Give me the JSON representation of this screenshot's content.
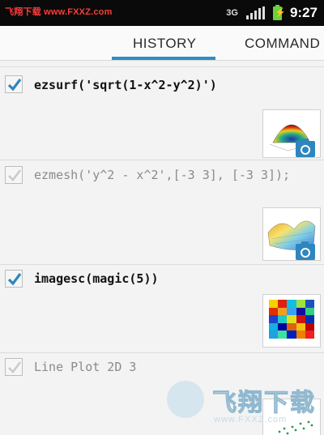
{
  "status_bar": {
    "watermark_prefix": "飞翔下载",
    "watermark_url": "www.FXXZ.com",
    "network_label": "3G",
    "time": "9:27"
  },
  "tabs": {
    "history_label": "HISTORY",
    "command_label": "COMMAND",
    "active": "HISTORY",
    "accent_color": "#2d8ec4"
  },
  "history_items": [
    {
      "command": "ezsurf('sqrt(1-x^2-y^2)')",
      "checked": true,
      "has_figure": true,
      "figure_icon": "surface-plot-thumbnail"
    },
    {
      "command": "ezmesh('y^2 - x^2',[-3 3], [-3 3]);",
      "checked": false,
      "has_figure": true,
      "figure_icon": "mesh-plot-thumbnail"
    },
    {
      "command": "imagesc(magic(5))",
      "checked": true,
      "has_figure": true,
      "figure_icon": "heatmap-thumbnail"
    },
    {
      "command": "Line Plot 2D 3",
      "checked": false,
      "has_figure": true,
      "figure_icon": "scatter-plot-thumbnail"
    }
  ],
  "bottom_watermark": {
    "text": "飞翔下载",
    "url": "www.FXXZ.com"
  }
}
